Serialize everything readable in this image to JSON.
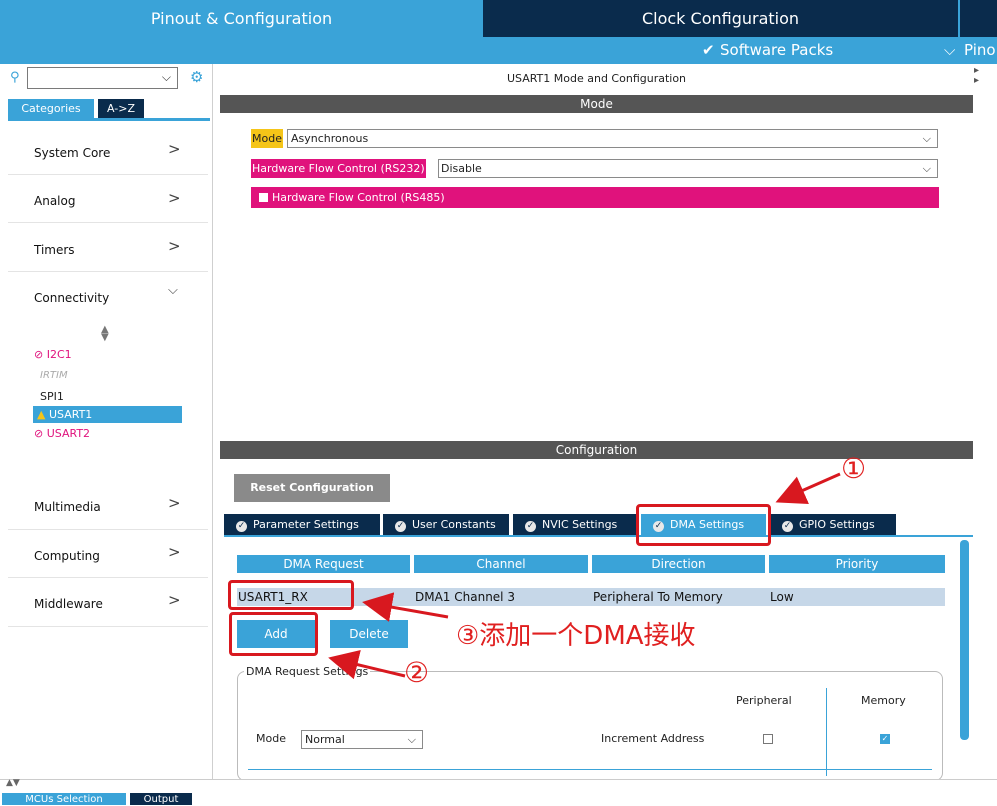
{
  "header": {
    "tab_pinout": "Pinout & Configuration",
    "tab_clock": "Clock Configuration",
    "software_packs": "Software Packs",
    "pinout_truncated": "Pino"
  },
  "left": {
    "tab_categories": "Categories",
    "tab_az": "A->Z",
    "categories": [
      "System Core",
      "Analog",
      "Timers",
      "Connectivity",
      "Multimedia",
      "Computing",
      "Middleware"
    ],
    "connectivity_items": [
      "I2C1",
      "IRTIM",
      "SPI1",
      "USART1",
      "USART2"
    ]
  },
  "mode_panel": {
    "title": "USART1 Mode and Configuration",
    "section_mode": "Mode",
    "mode_label": "Mode",
    "mode_value": "Asynchronous",
    "hw_flow_label": "Hardware Flow Control (RS232)",
    "hw_flow_value": "Disable",
    "hw_flow_rs485": "Hardware Flow Control (RS485)"
  },
  "config": {
    "section": "Configuration",
    "reset_button": "Reset Configuration",
    "tabs": [
      "Parameter Settings",
      "User Constants",
      "NVIC Settings",
      "DMA Settings",
      "GPIO Settings"
    ],
    "table_headers": [
      "DMA Request",
      "Channel",
      "Direction",
      "Priority"
    ],
    "rows": [
      {
        "request": "USART1_RX",
        "channel": "DMA1 Channel 3",
        "direction": "Peripheral To Memory",
        "priority": "Low"
      }
    ],
    "add_button": "Add",
    "delete_button": "Delete",
    "request_settings": "DMA Request Settings",
    "peripheral": "Peripheral",
    "memory": "Memory",
    "mode_label": "Mode",
    "mode_value": "Normal",
    "increment_address": "Increment Address",
    "memory_increment_checked": true
  },
  "annotations": {
    "one": "①",
    "two": "②",
    "three": "③添加一个DMA接收"
  },
  "bottom": {
    "mcus_selection": "MCUs Selection",
    "output": "Output"
  },
  "colors": {
    "accent": "#3aa3d8",
    "dark": "#0a2b4c",
    "magenta": "#e0127c",
    "warning": "#f5c518",
    "annotation_red": "#d8181f"
  }
}
